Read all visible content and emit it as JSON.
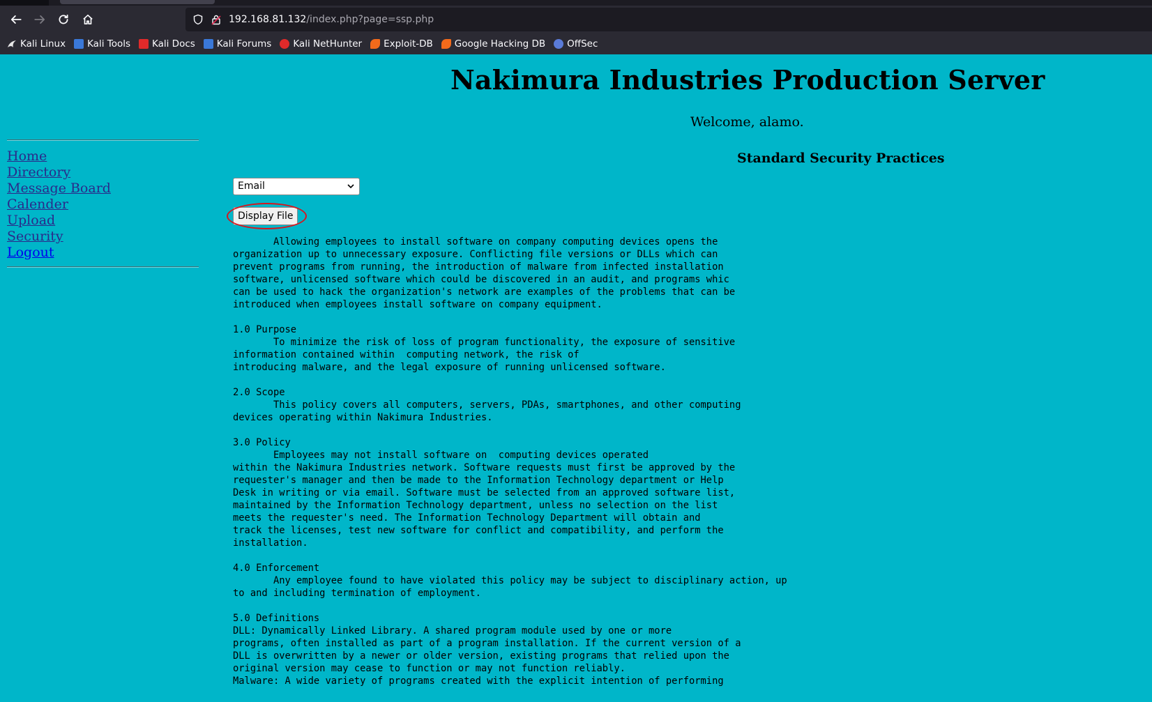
{
  "browser": {
    "url_host": "192.168.81.132",
    "url_path": "/index.php?page=ssp.php",
    "bookmarks": [
      {
        "label": "Kali Linux",
        "icon": "kali-dragon-icon",
        "color": "#e6e6e6"
      },
      {
        "label": "Kali Tools",
        "icon": "kali-tools-icon",
        "color": "#3a78d8"
      },
      {
        "label": "Kali Docs",
        "icon": "kali-docs-icon",
        "color": "#e02a2a"
      },
      {
        "label": "Kali Forums",
        "icon": "kali-forums-icon",
        "color": "#3a78d8"
      },
      {
        "label": "Kali NetHunter",
        "icon": "nethunter-icon",
        "color": "#e02a2a"
      },
      {
        "label": "Exploit-DB",
        "icon": "exploit-db-icon",
        "color": "#f26a1b"
      },
      {
        "label": "Google Hacking DB",
        "icon": "ghdb-icon",
        "color": "#f26a1b"
      },
      {
        "label": "OffSec",
        "icon": "offsec-icon",
        "color": "#5a7bd8"
      }
    ]
  },
  "page": {
    "title": "Nakimura Industries Production Server",
    "welcome": "Welcome, alamo.",
    "section_title": "Standard Security Practices",
    "nav": [
      {
        "label": "Home"
      },
      {
        "label": "Directory"
      },
      {
        "label": "Message Board"
      },
      {
        "label": "Calender"
      },
      {
        "label": "Upload"
      },
      {
        "label": "Security"
      },
      {
        "label": "Logout"
      }
    ],
    "file_select": {
      "selected": "Email"
    },
    "display_button": "Display File",
    "highlight_color": "#d9141c",
    "document": "       Allowing employees to install software on company computing devices opens the\norganization up to unnecessary exposure. Conflicting file versions or DLLs which can\nprevent programs from running, the introduction of malware from infected installation\nsoftware, unlicensed software which could be discovered in an audit, and programs whic\ncan be used to hack the organization's network are examples of the problems that can be\nintroduced when employees install software on company equipment.\n\n1.0 Purpose\n       To minimize the risk of loss of program functionality, the exposure of sensitive\ninformation contained within  computing network, the risk of\nintroducing malware, and the legal exposure of running unlicensed software.\n\n2.0 Scope\n       This policy covers all computers, servers, PDAs, smartphones, and other computing\ndevices operating within Nakimura Industries.\n\n3.0 Policy\n       Employees may not install software on  computing devices operated\nwithin the Nakimura Industries network. Software requests must first be approved by the\nrequester's manager and then be made to the Information Technology department or Help\nDesk in writing or via email. Software must be selected from an approved software list,\nmaintained by the Information Technology department, unless no selection on the list\nmeets the requester's need. The Information Technology Department will obtain and\ntrack the licenses, test new software for conflict and compatibility, and perform the\ninstallation.\n\n4.0 Enforcement\n       Any employee found to have violated this policy may be subject to disciplinary action, up\nto and including termination of employment.\n\n5.0 Definitions\nDLL: Dynamically Linked Library. A shared program module used by one or more\nprograms, often installed as part of a program installation. If the current version of a\nDLL is overwritten by a newer or older version, existing programs that relied upon the\noriginal version may cease to function or may not function reliably.\nMalware: A wide variety of programs created with the explicit intention of performing"
  },
  "colors": {
    "page_background": "#00b6c9",
    "active_link": "#0000ee",
    "visited_link": "#2a2a8a"
  }
}
